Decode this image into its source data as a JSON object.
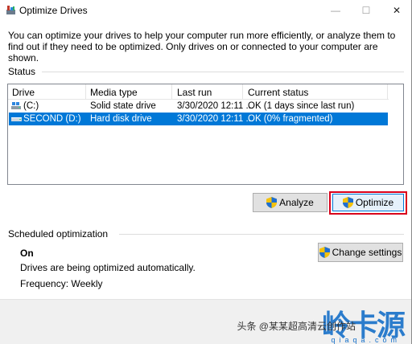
{
  "window": {
    "title": "Optimize Drives",
    "minimize_glyph": "—",
    "maximize_glyph": "☐",
    "close_glyph": "✕"
  },
  "intro": "You can optimize your drives to help your computer run more efficiently, or analyze them to find out if they need to be optimized. Only drives on or connected to your computer are shown.",
  "status": {
    "label": "Status",
    "columns": [
      "Drive",
      "Media type",
      "Last run",
      "Current status"
    ],
    "rows": [
      {
        "drive": "(C:)",
        "media": "Solid state drive",
        "last_run": "3/30/2020 12:11 ...",
        "status": "OK (1 days since last run)",
        "selected": false
      },
      {
        "drive": "SECOND (D:)",
        "media": "Hard disk drive",
        "last_run": "3/30/2020 12:11 ...",
        "status": "OK (0% fragmented)",
        "selected": true
      }
    ]
  },
  "buttons": {
    "analyze": "Analyze",
    "optimize": "Optimize",
    "change_settings": "Change settings"
  },
  "scheduled": {
    "label": "Scheduled optimization",
    "state": "On",
    "description": "Drives are being optimized automatically.",
    "frequency": "Frequency: Weekly"
  },
  "watermark": {
    "text": "头条 @某某超高清云创作站",
    "logo": "岭卡源",
    "domain": "qiaqa.com"
  },
  "colors": {
    "selection": "#0078d7",
    "highlight_box": "#d9001b",
    "watermark_blue": "#1670c9"
  }
}
